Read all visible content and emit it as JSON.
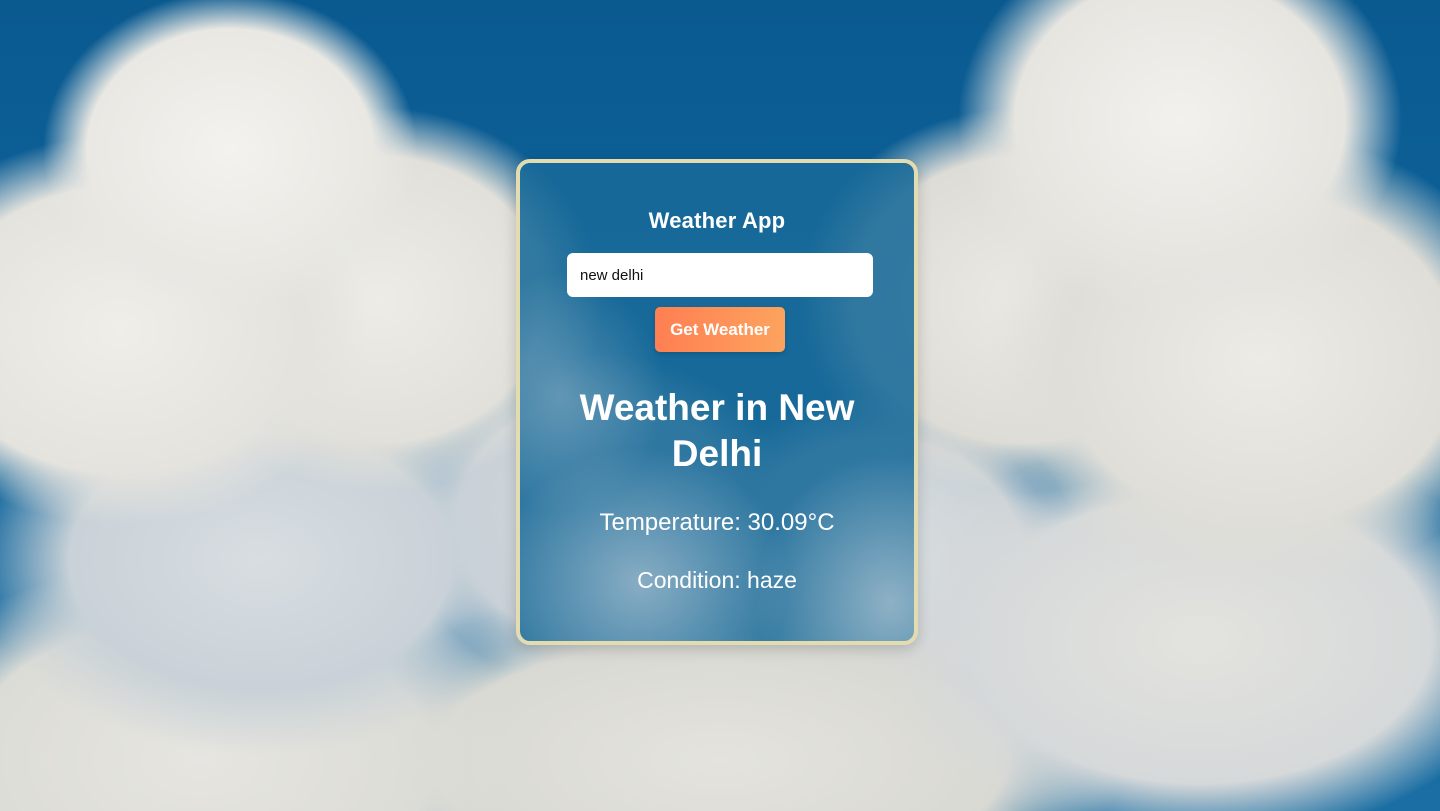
{
  "app": {
    "title": "Weather App"
  },
  "search": {
    "value": "new delhi",
    "button_label": "Get Weather"
  },
  "result": {
    "heading": "Weather in New Delhi",
    "temperature": "Temperature: 30.09°C",
    "condition": "Condition: haze"
  },
  "colors": {
    "card_border": "#e3dcb0",
    "button_start": "#ff7f52",
    "button_end": "#fda35e",
    "sky": "#0b5d93"
  }
}
